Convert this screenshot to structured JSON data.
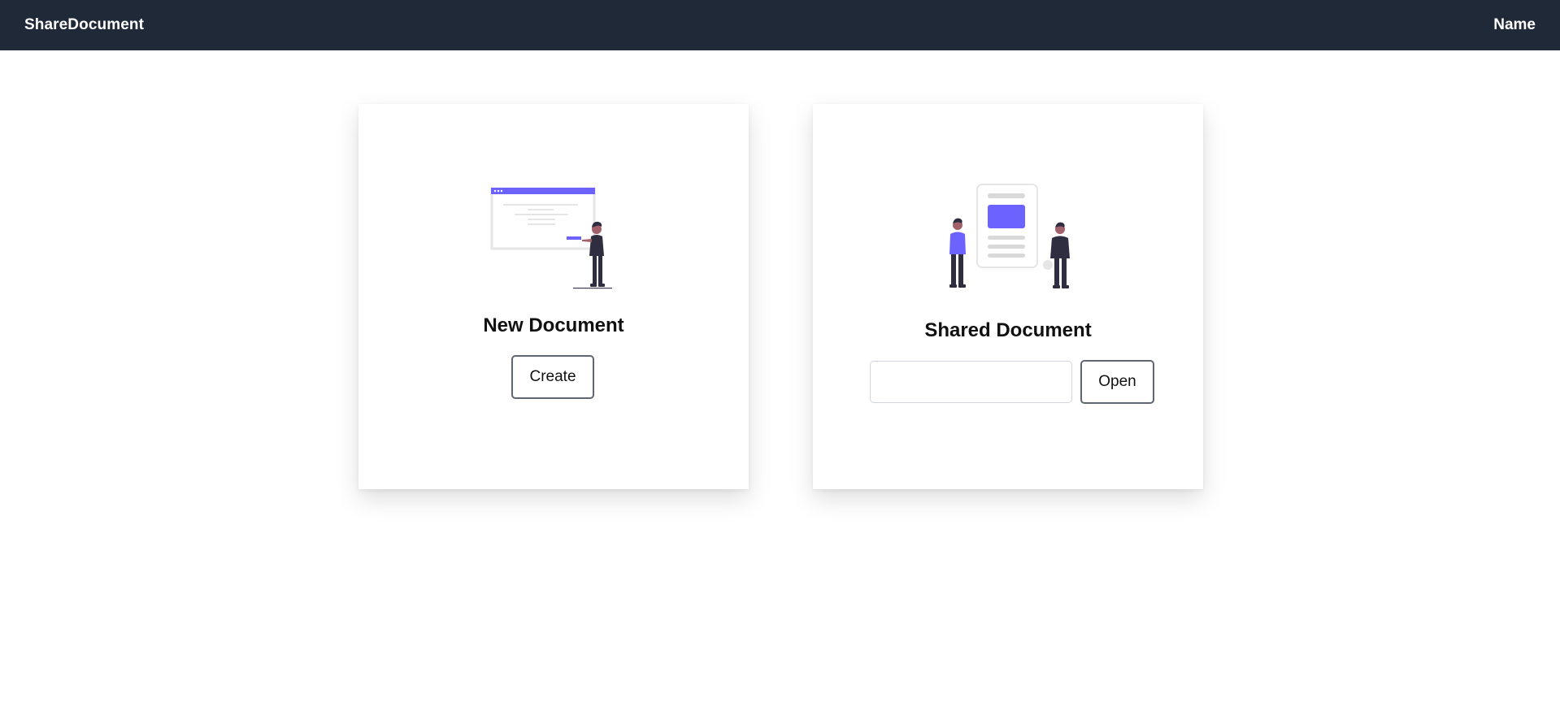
{
  "app": {
    "brand": "ShareDocument",
    "user_name": "Name"
  },
  "new_document": {
    "illustration_icon": "document-presentation-illustration",
    "title": "New Document",
    "button_label": "Create"
  },
  "shared_document": {
    "illustration_icon": "people-sharing-document-illustration",
    "title": "Shared Document",
    "input_value": "",
    "input_placeholder": "",
    "button_label": "Open"
  },
  "colors": {
    "navbar_bg": "#202938",
    "accent": "#6c63ff",
    "button_border": "#5f6673"
  }
}
